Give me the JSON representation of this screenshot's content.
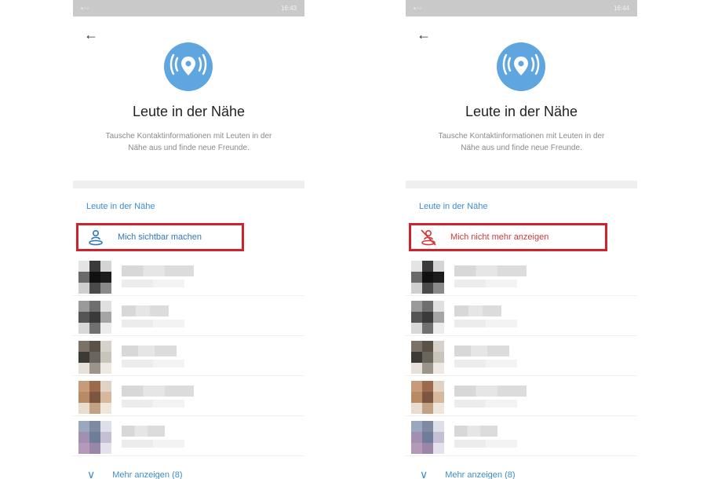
{
  "screens": [
    {
      "status_time": "16:43",
      "back_glyph": "←",
      "title": "Leute in der Nähe",
      "description": "Tausche Kontaktinformationen mit Leuten in der Nähe aus und finde neue Freunde.",
      "section_header": "Leute in der Nähe",
      "visibility_action": {
        "label": "Mich sichtbar machen",
        "color": "#2f78b8",
        "icon": "person-location-icon"
      },
      "more_link": "Mehr anzeigen (8)"
    },
    {
      "status_time": "16:44",
      "back_glyph": "←",
      "title": "Leute in der Nähe",
      "description": "Tausche Kontaktinformationen mit Leuten in der Nähe aus und finde neue Freunde.",
      "section_header": "Leute in der Nähe",
      "visibility_action": {
        "label": "Mich nicht mehr anzeigen",
        "color": "#d23a3a",
        "icon": "person-location-off-icon"
      },
      "more_link": "Mehr anzeigen (8)"
    }
  ],
  "colors": {
    "accent": "#5fa5df",
    "highlight_box": "#d0222a"
  }
}
